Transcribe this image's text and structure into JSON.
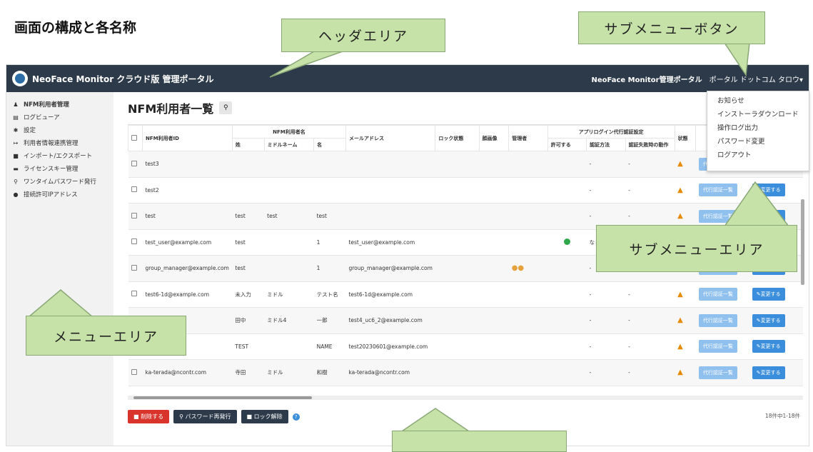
{
  "doc_title": "画面の構成と各名称",
  "callouts": {
    "header": "ヘッダエリア",
    "submenu_button": "サブメニューボタン",
    "submenu_area": "サブメニューエリア",
    "menu_area": "メニューエリア",
    "bottom": ""
  },
  "header": {
    "brand": "NeoFace Monitor クラウド版 管理ポータル",
    "portal_link": "NeoFace Monitor管理ポータル",
    "user": "ポータル ドットコム タロウ▾"
  },
  "sidebar": {
    "items": [
      {
        "icon": "user-icon",
        "label": "NFM利用者管理"
      },
      {
        "icon": "log-icon",
        "label": "ログビューア"
      },
      {
        "icon": "gear-icon",
        "label": "設定"
      },
      {
        "icon": "link-icon",
        "label": "利用者情報連携管理"
      },
      {
        "icon": "file-icon",
        "label": "インポート/エクスポート"
      },
      {
        "icon": "license-icon",
        "label": "ライセンスキー管理"
      },
      {
        "icon": "key-icon",
        "label": "ワンタイムパスワード発行"
      },
      {
        "icon": "pin-icon",
        "label": "接続許可IPアドレス"
      }
    ]
  },
  "page_title": "NFM利用者一覧",
  "table": {
    "headers": {
      "id": "NFM利用者ID",
      "name_group": "NFM利用者名",
      "last": "姓",
      "middle": "ミドルネーム",
      "first": "名",
      "email": "メールアドレス",
      "lock": "ロック状態",
      "face": "顔画像",
      "admin": "管理者",
      "proxy_group": "アプリログイン代行認証設定",
      "allow": "許可する",
      "method": "認証方法",
      "fail": "認証失敗時の動作",
      "status": "状態"
    },
    "rows": [
      {
        "id": "test3",
        "last": "",
        "middle": "",
        "first": "",
        "email": "",
        "admin": false,
        "allow": false,
        "method": "-",
        "fail": "-"
      },
      {
        "id": "test2",
        "last": "",
        "middle": "",
        "first": "",
        "email": "",
        "admin": false,
        "allow": false,
        "method": "-",
        "fail": "-"
      },
      {
        "id": "test",
        "last": "test",
        "middle": "test",
        "first": "test",
        "email": "",
        "admin": false,
        "allow": false,
        "method": "-",
        "fail": "-"
      },
      {
        "id": "test_user@example.com",
        "last": "test",
        "middle": "",
        "first": "1",
        "email": "test_user@example.com",
        "admin": false,
        "allow": true,
        "method": "なし",
        "fail": ""
      },
      {
        "id": "group_manager@example.com",
        "last": "test",
        "middle": "",
        "first": "1",
        "email": "group_manager@example.com",
        "admin": true,
        "allow": false,
        "method": "-",
        "fail": ""
      },
      {
        "id": "test6-1d@example.com",
        "last": "未入力",
        "middle": "ミドル",
        "first": "テスト名",
        "email": "test6-1d@example.com",
        "admin": false,
        "allow": false,
        "method": "-",
        "fail": "-"
      },
      {
        "id": "e.com",
        "last": "田中",
        "middle": "ミドル4",
        "first": "一郎",
        "email": "test4_uc6_2@example.com",
        "admin": false,
        "allow": false,
        "method": "-",
        "fail": "-"
      },
      {
        "id": "ple.com",
        "last": "TEST",
        "middle": "",
        "first": "NAME",
        "email": "test20230601@example.com",
        "admin": false,
        "allow": false,
        "method": "-",
        "fail": "-"
      },
      {
        "id": "ka-terada@ncontr.com",
        "last": "寺田",
        "middle": "ミドル",
        "first": "和樹",
        "email": "ka-terada@ncontr.com",
        "admin": false,
        "allow": false,
        "method": "-",
        "fail": "-"
      }
    ],
    "proxy_btn": "代行認証一覧",
    "edit_btn": "✎変更する"
  },
  "actions": {
    "delete": "削除する",
    "reissue": "パスワード再発行",
    "unlock": "ロック解除"
  },
  "count": "18件中1-18件",
  "submenu": [
    "お知らせ",
    "インストーラダウンロード",
    "操作ログ出力",
    "パスワード変更",
    "ログアウト"
  ]
}
